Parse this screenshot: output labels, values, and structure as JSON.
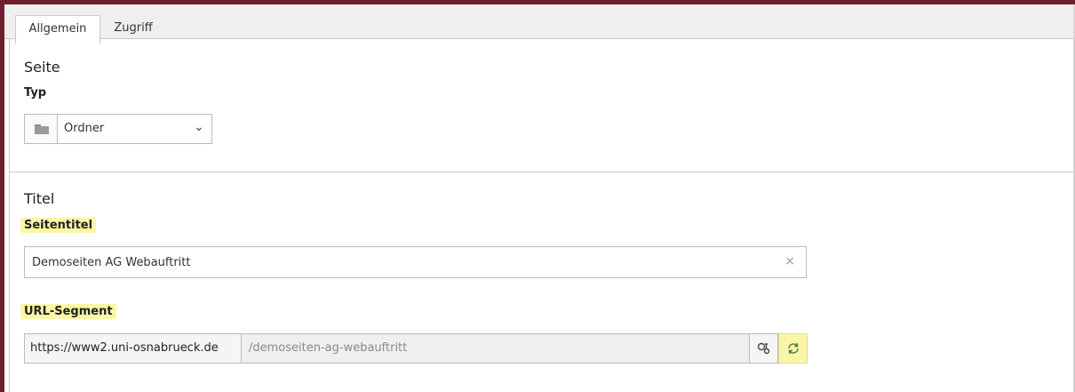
{
  "tabs": [
    {
      "label": "Allgemein",
      "active": true
    },
    {
      "label": "Zugriff",
      "active": false
    }
  ],
  "sections": {
    "seite": {
      "title": "Seite",
      "type_label": "Typ",
      "type_select": {
        "icon": "folder-icon",
        "value": "Ordner"
      }
    },
    "titel": {
      "title": "Titel",
      "seitentitel_label": "Seitentitel",
      "seitentitel_value": "Demoseiten AG Webauftritt",
      "url_label": "URL-Segment",
      "url_prefix": "https://www2.uni-osnabrueck.de",
      "url_value": "/demoseiten-ag-webauftritt"
    }
  },
  "icons": {
    "clear": "close-icon",
    "toggle": "unlink-toggle-icon",
    "refresh": "refresh-icon"
  },
  "colors": {
    "frame": "#6b2030",
    "highlight": "#fbf6a7"
  }
}
